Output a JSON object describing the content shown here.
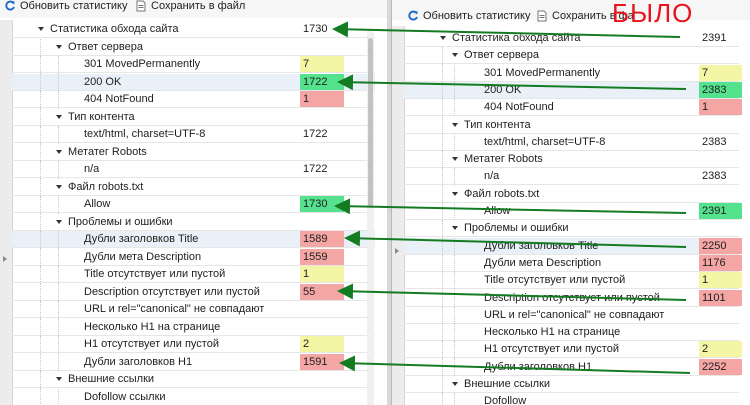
{
  "toolbar": {
    "refresh_label": "Обновить статистику",
    "save_label": "Сохранить в файл"
  },
  "right_toolbar": {
    "refresh_label": "Обновить статистику",
    "save_label": "Сохранить в фа"
  },
  "stamp_text": "БЫЛО",
  "colors": {
    "yellow": "#f5f5a6",
    "green": "#55e28e",
    "red": "#f3a6a3",
    "arrow": "#137c22"
  },
  "left_tree": [
    {
      "level": 0,
      "expander": true,
      "label": "Статистика обхода сайта",
      "value": "1730"
    },
    {
      "level": 1,
      "expander": true,
      "label": "Ответ сервера",
      "value": ""
    },
    {
      "level": 2,
      "label": "301 MovedPermanently",
      "value": "7",
      "color": "yellow"
    },
    {
      "level": 2,
      "label": "200 OK",
      "value": "1722",
      "color": "green",
      "selected": true
    },
    {
      "level": 2,
      "label": "404 NotFound",
      "value": "1",
      "color": "red"
    },
    {
      "level": 1,
      "expander": true,
      "label": "Тип контента",
      "value": ""
    },
    {
      "level": 2,
      "label": "text/html, charset=UTF-8",
      "value": "1722"
    },
    {
      "level": 1,
      "expander": true,
      "label": "Метатег Robots",
      "value": ""
    },
    {
      "level": 2,
      "label": "n/a",
      "value": "1722"
    },
    {
      "level": 1,
      "expander": true,
      "label": "Файл robots.txt",
      "value": ""
    },
    {
      "level": 2,
      "label": "Allow",
      "value": "1730",
      "color": "green"
    },
    {
      "level": 1,
      "expander": true,
      "label": "Проблемы и ошибки",
      "value": ""
    },
    {
      "level": 2,
      "label": "Дубли заголовков Title",
      "value": "1589",
      "color": "red",
      "selected": true
    },
    {
      "level": 2,
      "label": "Дубли мета Description",
      "value": "1559",
      "color": "red"
    },
    {
      "level": 2,
      "label": "Title отсутствует или пустой",
      "value": "1",
      "color": "yellow"
    },
    {
      "level": 2,
      "label": "Description отсутствует или пустой",
      "value": "55",
      "color": "red"
    },
    {
      "level": 2,
      "label": "URL и rel=\"canonical\" не совпадают",
      "value": ""
    },
    {
      "level": 2,
      "label": "Несколько H1 на странице",
      "value": ""
    },
    {
      "level": 2,
      "label": "H1 отсутствует или пустой",
      "value": "2",
      "color": "yellow"
    },
    {
      "level": 2,
      "label": "Дубли заголовков H1",
      "value": "1591",
      "color": "red"
    },
    {
      "level": 1,
      "expander": true,
      "label": "Внешние ссылки",
      "value": ""
    },
    {
      "level": 2,
      "label": "Dofollow ссылки",
      "value": ""
    }
  ],
  "right_tree": [
    {
      "level": 0,
      "expander": true,
      "label": "Статистика обхода сайта",
      "value": "2391"
    },
    {
      "level": 1,
      "expander": true,
      "label": "Ответ сервера",
      "value": ""
    },
    {
      "level": 2,
      "label": "301 MovedPermanently",
      "value": "7",
      "color": "yellow"
    },
    {
      "level": 2,
      "label": "200 OK",
      "value": "2383",
      "color": "green",
      "selected": true
    },
    {
      "level": 2,
      "label": "404 NotFound",
      "value": "1",
      "color": "red"
    },
    {
      "level": 1,
      "expander": true,
      "label": "Тип контента",
      "value": ""
    },
    {
      "level": 2,
      "label": "text/html, charset=UTF-8",
      "value": "2383"
    },
    {
      "level": 1,
      "expander": true,
      "label": "Метатег Robots",
      "value": ""
    },
    {
      "level": 2,
      "label": "n/a",
      "value": "2383"
    },
    {
      "level": 1,
      "expander": true,
      "label": "Файл robots.txt",
      "value": ""
    },
    {
      "level": 2,
      "label": "Allow",
      "value": "2391",
      "color": "green"
    },
    {
      "level": 1,
      "expander": true,
      "label": "Проблемы и ошибки",
      "value": ""
    },
    {
      "level": 2,
      "label": "Дубли заголовков Title",
      "value": "2250",
      "color": "red",
      "selected": true
    },
    {
      "level": 2,
      "label": "Дубли мета Description",
      "value": "1176",
      "color": "red"
    },
    {
      "level": 2,
      "label": "Title отсутствует или пустой",
      "value": "1",
      "color": "yellow"
    },
    {
      "level": 2,
      "label": "Description отсутствует или пустой",
      "value": "1101",
      "color": "red"
    },
    {
      "level": 2,
      "label": "URL и rel=\"canonical\" не совпадают",
      "value": ""
    },
    {
      "level": 2,
      "label": "Несколько H1 на странице",
      "value": ""
    },
    {
      "level": 2,
      "label": "H1 отсутствует или пустой",
      "value": "2",
      "color": "yellow"
    },
    {
      "level": 2,
      "label": "Дубли заголовков H1",
      "value": "2252",
      "color": "red"
    },
    {
      "level": 1,
      "expander": true,
      "label": "Внешние ссылки",
      "value": ""
    },
    {
      "level": 2,
      "label": "Dofollow",
      "value": ""
    }
  ]
}
